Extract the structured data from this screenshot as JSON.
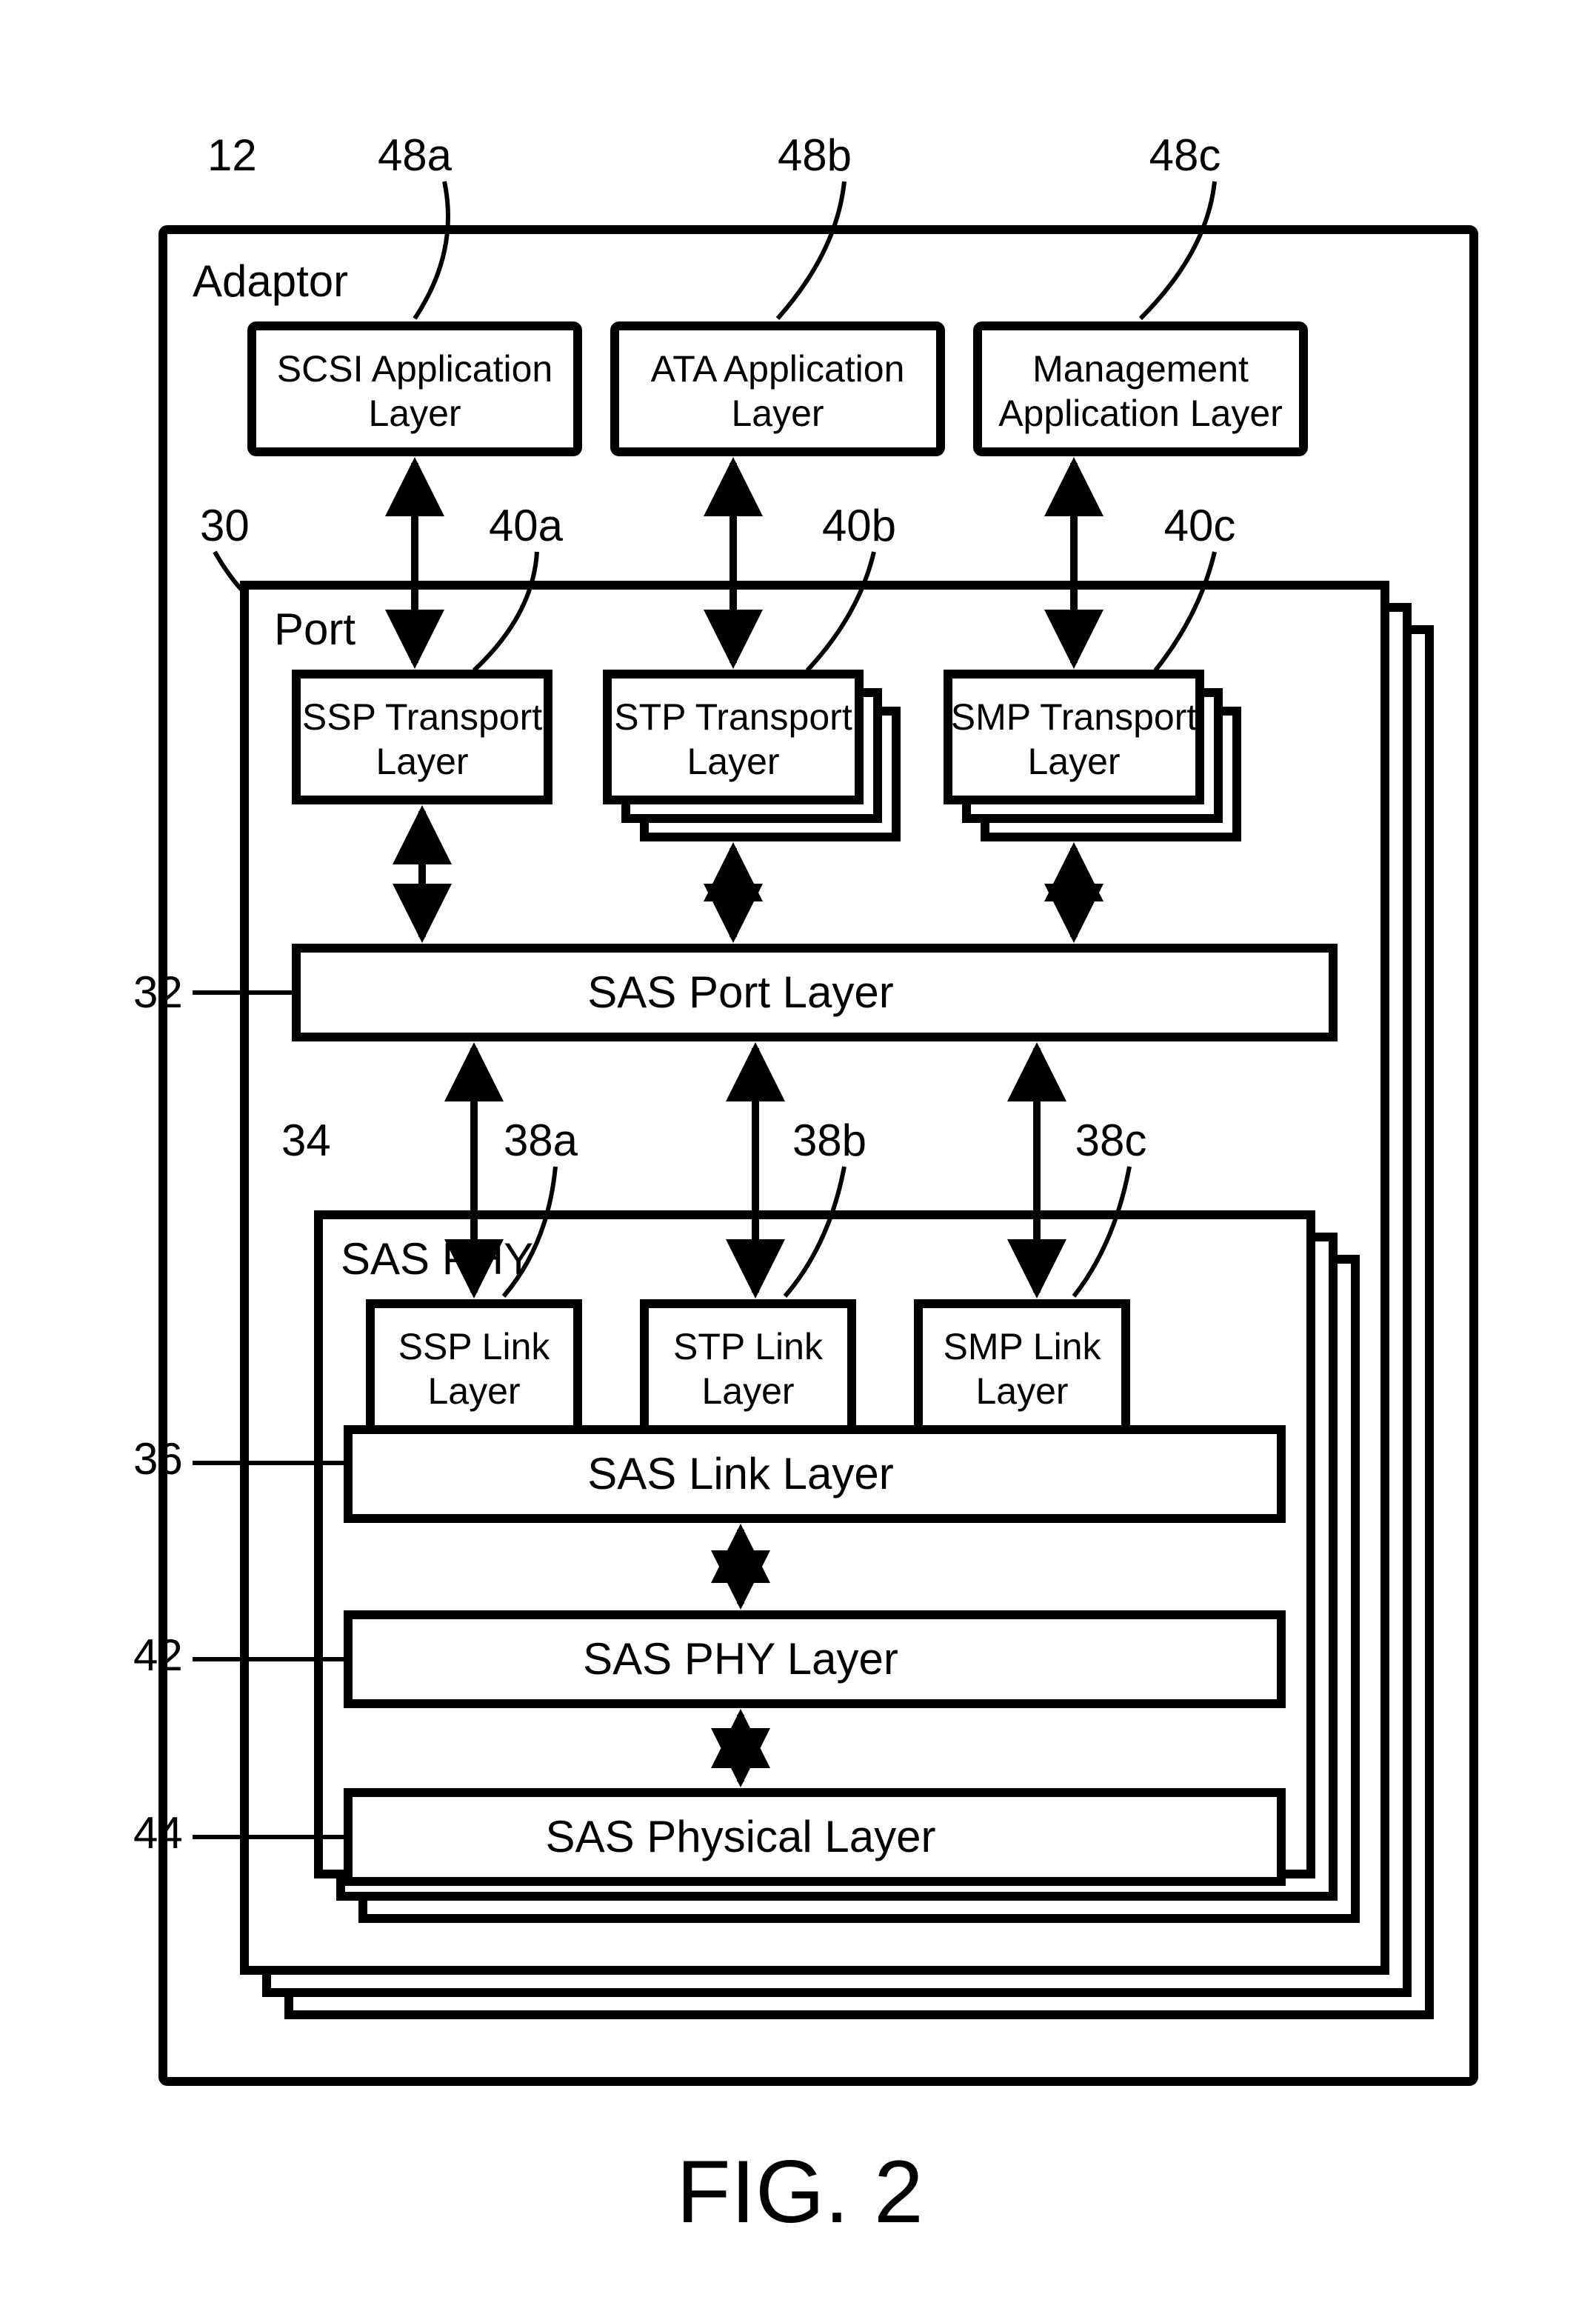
{
  "figure_label": "FIG. 2",
  "ref": {
    "adaptor": "12",
    "port": "30",
    "sas_port_layer": "32",
    "sas_phy": "34",
    "sas_link_layer": "36",
    "link_a": "38a",
    "link_b": "38b",
    "link_c": "38c",
    "trans_a": "40a",
    "trans_b": "40b",
    "trans_c": "40c",
    "sas_phy_layer": "42",
    "sas_physical": "44",
    "app_a": "48a",
    "app_b": "48b",
    "app_c": "48c"
  },
  "labels": {
    "adaptor": "Adaptor",
    "port": "Port",
    "sas_phy": "SAS PHY",
    "app_a_1": "SCSI Application",
    "app_a_2": "Layer",
    "app_b_1": "ATA Application",
    "app_b_2": "Layer",
    "app_c_1": "Management",
    "app_c_2": "Application Layer",
    "trans_a_1": "SSP Transport",
    "trans_a_2": "Layer",
    "trans_b_1": "STP Transport",
    "trans_b_2": "Layer",
    "trans_c_1": "SMP Transport",
    "trans_c_2": "Layer",
    "sas_port_layer": "SAS Port Layer",
    "link_a_1": "SSP Link",
    "link_a_2": "Layer",
    "link_b_1": "STP Link",
    "link_b_2": "Layer",
    "link_c_1": "SMP Link",
    "link_c_2": "Layer",
    "sas_link_layer": "SAS Link Layer",
    "sas_phy_layer": "SAS PHY Layer",
    "sas_physical": "SAS Physical Layer"
  }
}
